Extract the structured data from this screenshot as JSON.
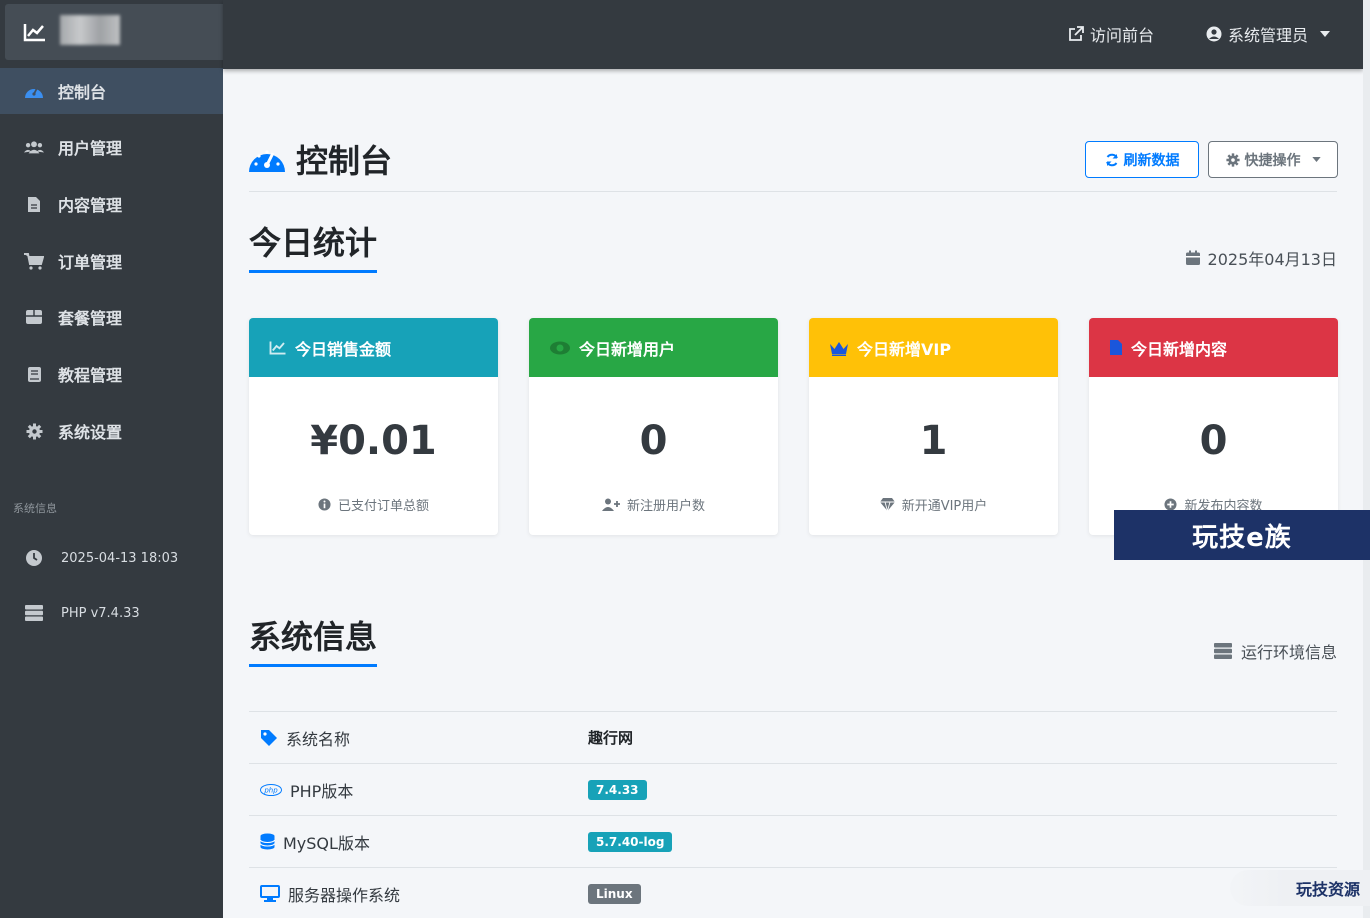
{
  "topbar": {
    "visit_frontend": "访问前台",
    "admin_user": "系统管理员"
  },
  "sidebar": {
    "items": [
      {
        "label": "控制台",
        "icon": "dashboard-icon",
        "active": true
      },
      {
        "label": "用户管理",
        "icon": "users-icon"
      },
      {
        "label": "内容管理",
        "icon": "file-icon"
      },
      {
        "label": "订单管理",
        "icon": "cart-icon"
      },
      {
        "label": "套餐管理",
        "icon": "box-icon"
      },
      {
        "label": "教程管理",
        "icon": "book-icon"
      },
      {
        "label": "系统设置",
        "icon": "gear-icon"
      }
    ],
    "info_header": "系统信息",
    "datetime": "2025-04-13 18:03",
    "php_version": "PHP v7.4.33"
  },
  "page": {
    "title": "控制台",
    "refresh_button": "刷新数据",
    "quick_actions_button": "快捷操作"
  },
  "today": {
    "title": "今日统计",
    "date": "2025年04月13日",
    "cards": [
      {
        "title": "今日销售金额",
        "value": "¥0.01",
        "sub": "已支付订单总额",
        "color": "#17a2b8"
      },
      {
        "title": "今日新增用户",
        "value": "0",
        "sub": "新注册用户数",
        "color": "#28a745"
      },
      {
        "title": "今日新增VIP",
        "value": "1",
        "sub": "新开通VIP用户",
        "color": "#ffc107"
      },
      {
        "title": "今日新增内容",
        "value": "0",
        "sub": "新发布内容数",
        "color": "#dc3545"
      }
    ]
  },
  "system": {
    "title": "系统信息",
    "runtime_label": "运行环境信息",
    "rows": [
      {
        "label": "系统名称",
        "value": "趣行网"
      },
      {
        "label": "PHP版本",
        "value": "7.4.33",
        "badge_color": "#17a2b8"
      },
      {
        "label": "MySQL版本",
        "value": "5.7.40-log",
        "badge_color": "#17a2b8"
      },
      {
        "label": "服务器操作系统",
        "value": "Linux",
        "badge_color": "#6c757d"
      }
    ]
  },
  "watermarks": {
    "main": "玩技e族",
    "corner": "玩技资源"
  },
  "colors": {
    "primary": "#007bff",
    "sidebar_bg": "#343a40",
    "active_bg": "#3f4f61"
  }
}
